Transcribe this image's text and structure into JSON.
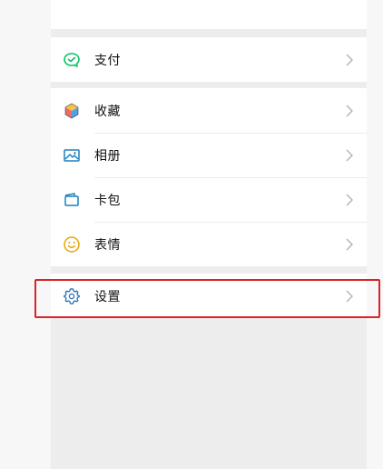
{
  "menu": {
    "pay": {
      "label": "支付",
      "icon": "pay-icon"
    },
    "favorites": {
      "label": "收藏",
      "icon": "favorites-cube-icon"
    },
    "album": {
      "label": "相册",
      "icon": "album-image-icon"
    },
    "cards": {
      "label": "卡包",
      "icon": "card-wallet-icon"
    },
    "stickers": {
      "label": "表情",
      "icon": "smiley-icon"
    },
    "settings": {
      "label": "设置",
      "icon": "gear-icon"
    }
  },
  "colors": {
    "panel_bg": "#ededed",
    "row_bg": "#ffffff",
    "page_bg": "#f7f7f7",
    "highlight": "#d9232a",
    "pay_green": "#07c160",
    "album_blue": "#1e7fc1",
    "stickers_yellow": "#e6a700",
    "settings_blue": "#2a6fb3"
  }
}
